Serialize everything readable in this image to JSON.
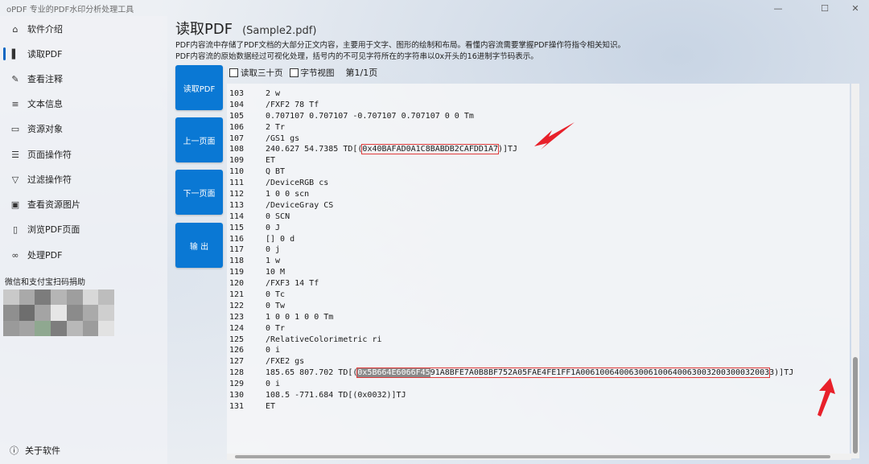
{
  "window": {
    "title": "oPDF 专业的PDF水印分析处理工具",
    "controls": [
      "—",
      "☐",
      "✕"
    ]
  },
  "sidebar": {
    "items": [
      {
        "label": "软件介绍",
        "icon": "home-icon",
        "glyph": "⌂"
      },
      {
        "label": "读取PDF",
        "icon": "bar-icon",
        "glyph": "▌"
      },
      {
        "label": "查看注释",
        "icon": "annotation-icon",
        "glyph": "✎"
      },
      {
        "label": "文本信息",
        "icon": "list-icon",
        "glyph": "≡"
      },
      {
        "label": "资源对象",
        "icon": "window-icon",
        "glyph": "▭"
      },
      {
        "label": "页面操作符",
        "icon": "list-icon",
        "glyph": "☰"
      },
      {
        "label": "过滤操作符",
        "icon": "filter-icon",
        "glyph": "▽"
      },
      {
        "label": "查看资源图片",
        "icon": "image-icon",
        "glyph": "▣"
      },
      {
        "label": "浏览PDF页面",
        "icon": "document-icon",
        "glyph": "▯"
      },
      {
        "label": "处理PDF",
        "icon": "link-icon",
        "glyph": "∞"
      }
    ],
    "active_index": 1,
    "donate_label": "微信和支付宝扫码捐助",
    "about_label": "关于软件",
    "about_glyph": "ⓘ"
  },
  "main": {
    "title": "读取PDF",
    "file": "(Sample2.pdf)",
    "desc1": "PDF内容流中存储了PDF文档的大部分正文内容，主要用于文字、图形的绘制和布局。看懂内容流需要掌握PDF操作符指令相关知识。",
    "desc2": "PDF内容流的原始数据经过可视化处理，括号内的不可见字符所在的字符串以0x开头的16进制字节码表示。",
    "buttons": [
      "读取PDF",
      "上一页面",
      "下一页面",
      "输  出"
    ],
    "options": [
      "读取三十页",
      "字节视图"
    ],
    "page_info": "第1/1页"
  },
  "code": {
    "lines": [
      {
        "n": "103",
        "t": "2 w"
      },
      {
        "n": "104",
        "t": "/FXF2 78 Tf"
      },
      {
        "n": "105",
        "t": "0.707107 0.707107 -0.707107 0.707107 0 0 Tm"
      },
      {
        "n": "106",
        "t": "2 Tr"
      },
      {
        "n": "107",
        "t": "/GS1 gs"
      },
      {
        "n": "108",
        "pre": "240.627 54.7385 TD[(",
        "hl": "0x40BAFAD0A1C8BABDB2CAFDD1A7",
        "post": ")]TJ"
      },
      {
        "n": "109",
        "t": "ET"
      },
      {
        "n": "110",
        "t": "Q BT"
      },
      {
        "n": "111",
        "t": "/DeviceRGB cs"
      },
      {
        "n": "112",
        "t": "1 0 0 scn"
      },
      {
        "n": "113",
        "t": "/DeviceGray CS"
      },
      {
        "n": "114",
        "t": "0 SCN"
      },
      {
        "n": "115",
        "t": "0 J"
      },
      {
        "n": "116",
        "t": "[] 0 d"
      },
      {
        "n": "117",
        "t": "0 j"
      },
      {
        "n": "118",
        "t": "1 w"
      },
      {
        "n": "119",
        "t": "10 M"
      },
      {
        "n": "120",
        "t": "/FXF3 14 Tf"
      },
      {
        "n": "121",
        "t": "0 Tc"
      },
      {
        "n": "122",
        "t": "0 Tw"
      },
      {
        "n": "123",
        "t": "1 0 0 1 0 0 Tm"
      },
      {
        "n": "124",
        "t": "0 Tr"
      },
      {
        "n": "125",
        "t": "/RelativeColorimetric ri"
      },
      {
        "n": "126",
        "t": "0 i"
      },
      {
        "n": "127",
        "t": "/FXE2 gs"
      },
      {
        "n": "128",
        "pre": "185.65 807.702 TD[(",
        "sel": "0x5B664E6066F45",
        "hl": "91A8BFE7A0B8BF752A05FAE4FE1FF1A006100640063006100640063003200300032003",
        "post": "3)]TJ"
      },
      {
        "n": "129",
        "t": "0 i"
      },
      {
        "n": "130",
        "t": "108.5 -771.684 TD[(0x0032)]TJ"
      },
      {
        "n": "131",
        "t": "ET"
      }
    ]
  },
  "colors": {
    "accent": "#0a78d4",
    "highlight": "#e03b3b",
    "arrow": "#e8202a"
  }
}
